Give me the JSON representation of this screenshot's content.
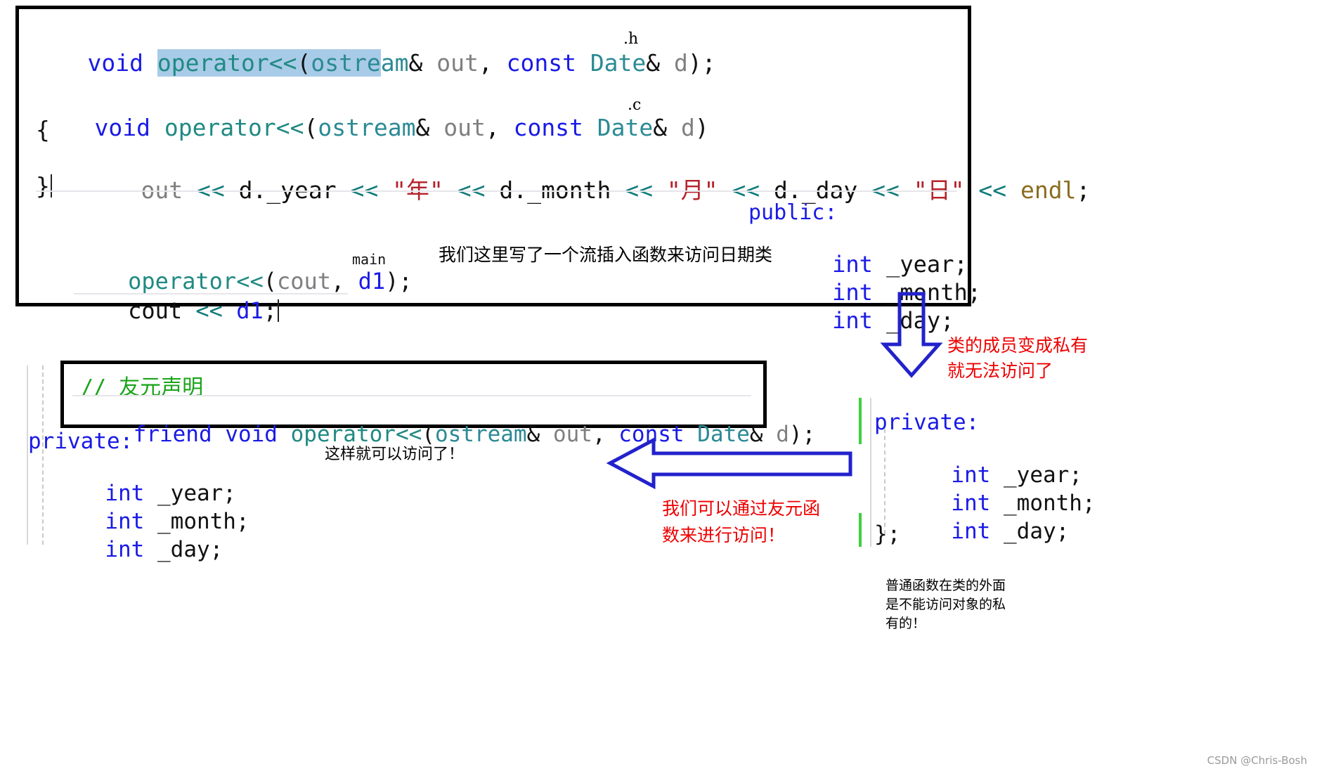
{
  "top_panel": {
    "header_decl": {
      "sel_pre": "vo",
      "sel_text": "id operator<<(ostre",
      "parts": [
        "void ",
        "operator<<",
        "(",
        "ostream",
        "& ",
        "out",
        ", ",
        "const ",
        "Date",
        "& ",
        "d",
        ");"
      ],
      "label": ".h"
    },
    "impl_signature": [
      "void ",
      "operator<<",
      "(",
      "ostream",
      "& ",
      "out",
      ", ",
      "const ",
      "Date",
      "& ",
      "d",
      ")"
    ],
    "impl_label": ".c",
    "brace_open": "{",
    "body_line": [
      "out",
      " << ",
      "d._year",
      " << ",
      "\"年\"",
      " << ",
      "d._month",
      " << ",
      "\"月\"",
      " << ",
      "d._day",
      " << ",
      "\"日\"",
      " << ",
      "endl",
      ";"
    ],
    "brace_close": "}",
    "main_call": [
      "operator<<",
      "(",
      "cout",
      ", ",
      "d1",
      ");"
    ],
    "main_label": "main",
    "cout_call": [
      "cout",
      " << ",
      "d1",
      ";"
    ],
    "annotation_cn": "我们这里写了一个流插入函数来访问日期类",
    "class_public": {
      "access": "public:",
      "members": [
        {
          "type": "int",
          "name": " _year;"
        },
        {
          "type": "int",
          "name": " _month;"
        },
        {
          "type": "int",
          "name": " _day;"
        }
      ]
    }
  },
  "friend_box": {
    "comment": "// 友元声明",
    "declaration": [
      "friend ",
      "void ",
      "operator<<",
      "(",
      "ostream",
      "& ",
      "out",
      ", ",
      "const ",
      "Date",
      "& ",
      "d",
      ");"
    ]
  },
  "left_class": {
    "access": "private:",
    "members": [
      {
        "type": "int",
        "name": " _year;"
      },
      {
        "type": "int",
        "name": " _month;"
      },
      {
        "type": "int",
        "name": " _day;"
      }
    ],
    "note_cn": "这样就可以访问了！"
  },
  "right_class": {
    "access": "private:",
    "members": [
      {
        "type": "int",
        "name": " _year;"
      },
      {
        "type": "int",
        "name": " _month;"
      },
      {
        "type": "int",
        "name": " _day;"
      }
    ],
    "close": "};"
  },
  "annotations": {
    "red_top_line1": "类的成员变成私有",
    "red_top_line2": "就无法访问了",
    "red_bottom_line1": "我们可以通过友元函",
    "red_bottom_line2": "数来进行访问！",
    "black_note_line1": "普通函数在类的外面",
    "black_note_line2": "是不能访问对象的私",
    "black_note_line3": "有的！"
  },
  "watermark": "CSDN @Chris-Bosh",
  "colors": {
    "keyword": "#1a1ae6",
    "type": "#2b8a94",
    "function": "#1f8a82",
    "variable": "#7f7f7f",
    "operator": "#0f7b7b",
    "string": "#b5222a",
    "macro": "#8a6d1f",
    "comment": "#19a319",
    "selection": "#a8cbe8",
    "red_annotation": "#ee0000",
    "arrow_blue": "#2222cc"
  }
}
